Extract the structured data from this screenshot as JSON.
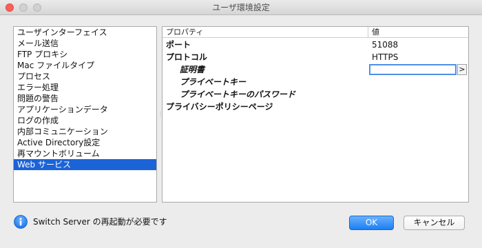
{
  "window": {
    "title": "ユーザ環境設定"
  },
  "categories": {
    "items": [
      {
        "label": "ユーザインターフェイス"
      },
      {
        "label": "メール送信"
      },
      {
        "label": "FTP プロキシ"
      },
      {
        "label": "Mac ファイルタイプ"
      },
      {
        "label": "プロセス"
      },
      {
        "label": "エラー処理"
      },
      {
        "label": "問題の警告"
      },
      {
        "label": "アプリケーションデータ"
      },
      {
        "label": "ログの作成"
      },
      {
        "label": "内部コミュニケーション"
      },
      {
        "label": "Active Directory設定"
      },
      {
        "label": "再マウントボリューム"
      },
      {
        "label": "Web サービス"
      }
    ],
    "selected": "Web サービス"
  },
  "properties": {
    "header_property": "プロパティ",
    "header_value": "値",
    "rows": [
      {
        "name": "ポート",
        "value": "51088"
      },
      {
        "name": "プロトコル",
        "value": "HTTPS"
      },
      {
        "name": "証明書",
        "value": ""
      },
      {
        "name": "プライベートキー",
        "value": ""
      },
      {
        "name": "プライベートキーのパスワード",
        "value": ""
      },
      {
        "name": "プライバシーポリシーページ",
        "value": ""
      }
    ],
    "browse_label": ">"
  },
  "status": {
    "message": "Switch Server の再起動が必要です",
    "icon": "info-icon"
  },
  "buttons": {
    "ok": "OK",
    "cancel": "キャンセル"
  },
  "colors": {
    "selection": "#1b63d7",
    "ok_button": "#1a7ff5",
    "info_icon": "#1a73e8"
  }
}
